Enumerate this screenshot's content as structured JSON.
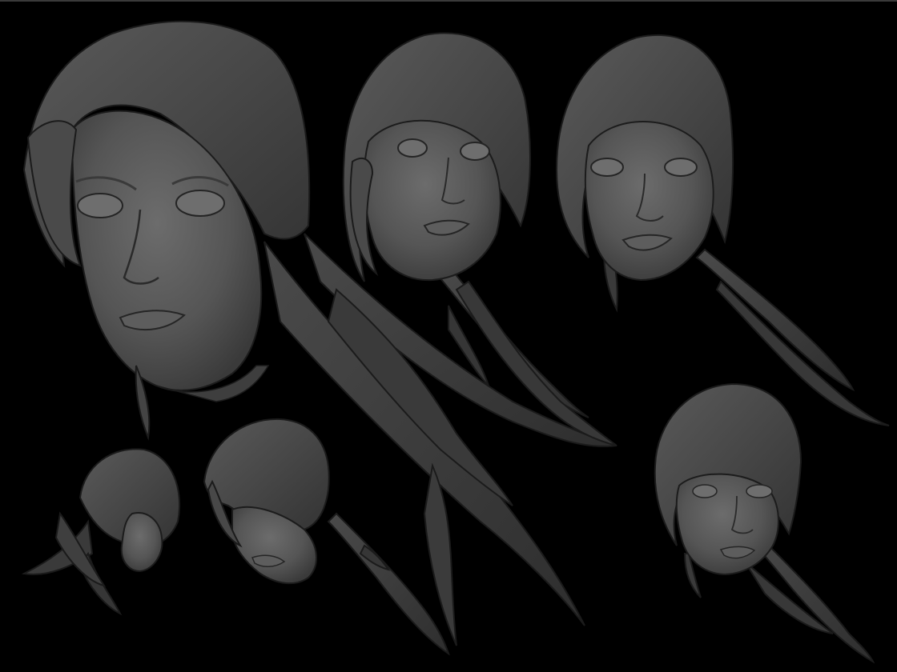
{
  "image": {
    "description_kind": "sculpt-render",
    "background_color": "#000000",
    "material_base": "#4e4e4e",
    "material_light": "#6a6a6a",
    "material_dark": "#2a2a2a",
    "outline_color": "#1a1a1a",
    "views": [
      {
        "id": "three-quarter-large"
      },
      {
        "id": "front-left"
      },
      {
        "id": "front-right"
      },
      {
        "id": "profile-right"
      },
      {
        "id": "three-quarter-down"
      },
      {
        "id": "three-quarter-small"
      }
    ]
  }
}
